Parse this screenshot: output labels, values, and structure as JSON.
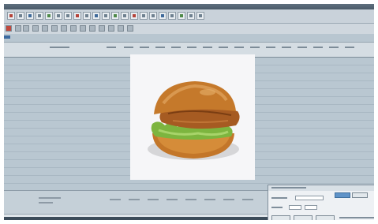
{
  "window": {
    "title": ""
  },
  "photo": {
    "alt": "hamburger photo",
    "background": "#f6f6f8"
  },
  "colors": {
    "desktop_bg": "#b8c6d0",
    "toolbar": "#c9d2da",
    "accent_blue": "#5f93c8",
    "bun": "#c77a2a",
    "lettuce": "#78b13c",
    "patty": "#a25a23"
  },
  "dialog": {
    "buttons": [
      "",
      "",
      "",
      ""
    ]
  },
  "icons": [
    "toolbar-icon",
    "toolbar-icon",
    "toolbar-icon"
  ]
}
